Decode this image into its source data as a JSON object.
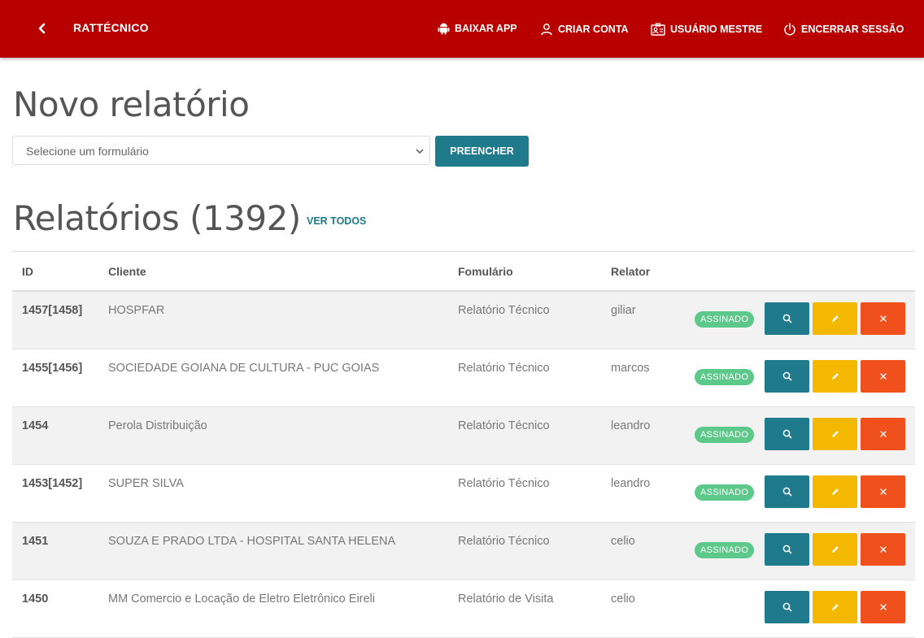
{
  "header": {
    "brand": "RATTÉCNICO",
    "nav": [
      {
        "label": "BAIXAR APP",
        "icon": "android-icon"
      },
      {
        "label": "CRIAR CONTA",
        "icon": "user-icon"
      },
      {
        "label": "USUÁRIO MESTRE",
        "icon": "id-card-icon"
      },
      {
        "label": "ENCERRAR SESSÃO",
        "icon": "power-icon"
      }
    ]
  },
  "new_report": {
    "title": "Novo relatório",
    "select_placeholder": "Selecione um formulário",
    "fill_button": "PREENCHER"
  },
  "reports": {
    "title": "Relatórios (1392)",
    "see_all": "VER TODOS",
    "columns": {
      "id": "ID",
      "client": "Cliente",
      "form": "Fomulário",
      "reporter": "Relator"
    },
    "rows": [
      {
        "id": "1457[1458]",
        "client": "HOSPFAR",
        "form": "Relatório Técnico",
        "reporter": "giliar",
        "status": "ASSINADO"
      },
      {
        "id": "1455[1456]",
        "client": "SOCIEDADE GOIANA DE CULTURA - PUC GOIAS",
        "form": "Relatório Técnico",
        "reporter": "marcos",
        "status": "ASSINADO"
      },
      {
        "id": "1454",
        "client": "Perola Distribuição",
        "form": "Relatório Técnico",
        "reporter": "leandro",
        "status": "ASSINADO"
      },
      {
        "id": "1453[1452]",
        "client": "SUPER SILVA",
        "form": "Relatório Técnico",
        "reporter": "leandro",
        "status": "ASSINADO"
      },
      {
        "id": "1451",
        "client": "SOUZA E PRADO LTDA - HOSPITAL SANTA HELENA",
        "form": "Relatório Técnico",
        "reporter": "celio",
        "status": "ASSINADO"
      },
      {
        "id": "1450",
        "client": "MM Comercio e Locação de Eletro Eletrônico Eireli",
        "form": "Relatório de Visita",
        "reporter": "celio",
        "status": ""
      }
    ]
  },
  "colors": {
    "header_bg": "#b80000",
    "primary": "#1f7a8c",
    "edit": "#f5b800",
    "delete": "#f0501c",
    "signed": "#5cc88a"
  }
}
